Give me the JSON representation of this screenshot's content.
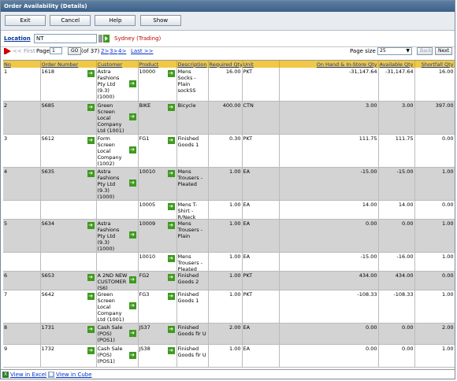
{
  "window": {
    "title": "Order Availability (Details)"
  },
  "toolbar": {
    "exit": "Exit",
    "cancel": "Cancel",
    "help": "Help",
    "show": "Show"
  },
  "location": {
    "label": "Location",
    "value": "NT",
    "name": "Sydney (Trading)"
  },
  "pager": {
    "first": "<< First",
    "page_label": "Page",
    "page_value": "1",
    "go": "GO",
    "of": "(of 37)",
    "p2": "2>",
    "p3": "3>",
    "p4": "4>",
    "last": "Last >>",
    "page_size_label": "Page size",
    "page_size": "25",
    "back": "Back",
    "next": "Next"
  },
  "columns": {
    "no": "No",
    "order": "Order Number",
    "customer": "Customer",
    "product": "Product",
    "description": "Description",
    "required": "Required Qty",
    "unit": "Unit",
    "onhand": "On Hand & In-Store Qty",
    "available": "Available Qty",
    "shortfall": "Shortfall Qty"
  },
  "rows": [
    {
      "no": "1",
      "order": "1618",
      "customer": "Astra Fashions Pty Ltd (9.3) (1000)",
      "product": "10000",
      "description": "Mens Socks - Plain sockSS",
      "required": "16.00",
      "unit": "PKT",
      "onhand": "-31,147.64",
      "available": "-31,147.64",
      "shortfall": "16.00"
    },
    {
      "no": "2",
      "order": "S685",
      "customer": "Green Screen Local Company Ltd (1001)",
      "product": "BIKE",
      "description": "Bicycle",
      "required": "400.00",
      "unit": "CTN",
      "onhand": "3.00",
      "available": "3.00",
      "shortfall": "397.00"
    },
    {
      "no": "3",
      "order": "S612",
      "customer": "Form Screen Local Company (1002)",
      "product": "FG1",
      "description": "Finished Goods 1",
      "required": "0.30",
      "unit": "PKT",
      "onhand": "111.75",
      "available": "111.75",
      "shortfall": "0.00"
    },
    {
      "no": "4",
      "order": "S635",
      "customer": "Astra Fashions Pty Ltd (9.3) (1000)",
      "product": "10010",
      "description": "Mens Trousers - Pleated",
      "required": "1.00",
      "unit": "EA",
      "onhand": "-15.00",
      "available": "-15.00",
      "shortfall": "1.00"
    },
    {
      "no": "",
      "order": "",
      "customer": "",
      "product": "10005",
      "description": "Mens T-Shirt - R/Neck",
      "required": "1.00",
      "unit": "EA",
      "onhand": "14.00",
      "available": "14.00",
      "shortfall": "0.00"
    },
    {
      "no": "5",
      "order": "S634",
      "customer": "Astra Fashions Pty Ltd (9.3) (1000)",
      "product": "10009",
      "description": "Mens Trousers - Plain",
      "required": "1.00",
      "unit": "EA",
      "onhand": "0.00",
      "available": "0.00",
      "shortfall": "1.00"
    },
    {
      "no": "",
      "order": "",
      "customer": "",
      "product": "10010",
      "description": "Mens Trousers - Pleated",
      "required": "1.00",
      "unit": "EA",
      "onhand": "-15.00",
      "available": "-16.00",
      "shortfall": "1.00"
    },
    {
      "no": "6",
      "order": "S653",
      "customer": "A 2ND NEW CUSTOMER (S6)",
      "product": "FG2",
      "description": "Finished Goods 2",
      "required": "1.00",
      "unit": "PKT",
      "onhand": "434.00",
      "available": "434.00",
      "shortfall": "0.00"
    },
    {
      "no": "7",
      "order": "S642",
      "customer": "Green Screen Local Company Ltd (1001)",
      "product": "FG3",
      "description": "Finished Goods 1",
      "required": "1.00",
      "unit": "PKT",
      "onhand": "-108.33",
      "available": "-108.33",
      "shortfall": "1.00"
    },
    {
      "no": "8",
      "order": "1731",
      "customer": "Cash Sale (POS) (POS1)",
      "product": "JS37",
      "description": "Finished Goods fir U",
      "required": "2.00",
      "unit": "EA",
      "onhand": "0.00",
      "available": "0.00",
      "shortfall": "2.00"
    },
    {
      "no": "9",
      "order": "1732",
      "customer": "Cash Sale (POS) (POS1)",
      "product": "JS38",
      "description": "Finished Goods fir U",
      "required": "1.00",
      "unit": "EA",
      "onhand": "0.00",
      "available": "0.00",
      "shortfall": "1.00"
    }
  ],
  "footer": {
    "excel": "View in Excel",
    "cube": "View in Cube"
  },
  "colors": {
    "header_bg": "#f0c846",
    "alt_row": "#d3d3d3",
    "go_arrow": "#3f9a1e",
    "location_name": "#c00000"
  }
}
